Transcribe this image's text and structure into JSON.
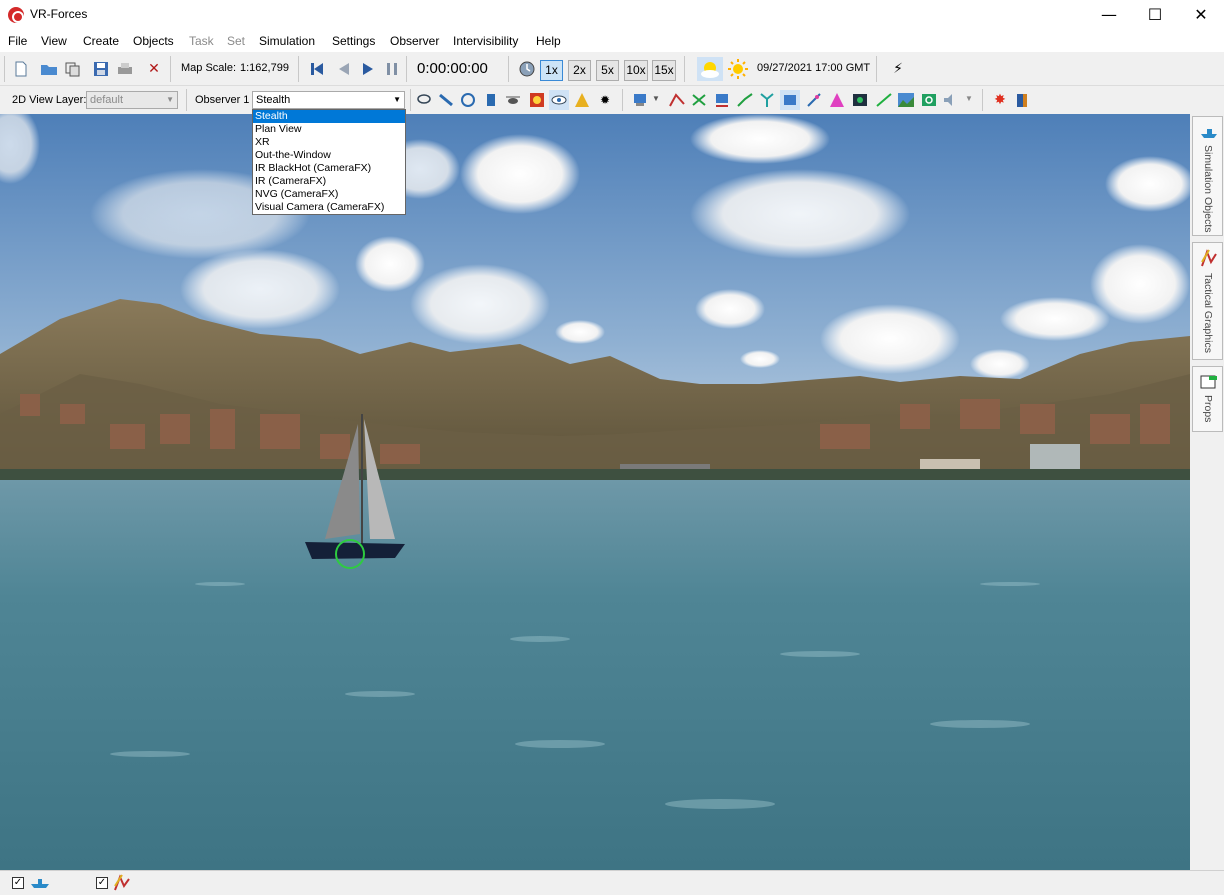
{
  "window": {
    "title": "VR-Forces",
    "minimize": "—",
    "maximize": "☐",
    "close": "✕"
  },
  "menu": [
    "File",
    "View",
    "Create",
    "Objects",
    "Task",
    "Set",
    "Simulation",
    "Settings",
    "Observer",
    "Intervisibility",
    "Help"
  ],
  "menu_disabled": [
    "Task",
    "Set"
  ],
  "toolbar": {
    "map_scale_label": "Map Scale:",
    "map_scale_value": "1:162,799",
    "time": "0:00:00:00",
    "speeds": [
      "1x",
      "2x",
      "5x",
      "10x",
      "15x"
    ],
    "active_speed": "1x",
    "datetime": "09/27/2021 17:00 GMT",
    "layer_label": "2D View Layer:",
    "layer_value": "default",
    "observer_label": "Observer 1",
    "observer_value": "Stealth"
  },
  "observer_modes": [
    "Stealth",
    "Plan View",
    "XR",
    "Out-the-Window",
    "IR BlackHot (CameraFX)",
    "IR (CameraFX)",
    "NVG (CameraFX)",
    "Visual Camera (CameraFX)"
  ],
  "side_tabs": [
    "Simulation Objects",
    "Tactical Graphics",
    "Props"
  ],
  "status": {
    "check1": "✓",
    "check2": "✓"
  },
  "colors": {
    "sky_top": "#4f7fb8",
    "sky_bottom": "#c6d6e6",
    "water": "#4a7f90",
    "selection": "#0078d7",
    "target_ring": "#2ecc40"
  }
}
